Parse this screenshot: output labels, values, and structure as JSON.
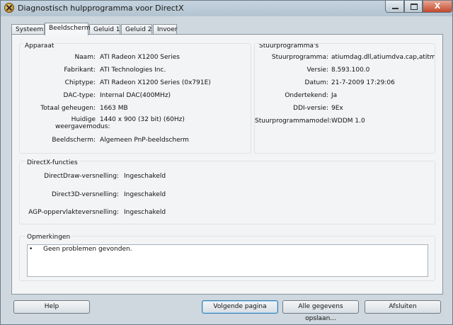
{
  "window": {
    "title": "Diagnostisch hulpprogramma voor DirectX"
  },
  "tabs": [
    "Systeem",
    "Beeldscherm",
    "Geluid 1",
    "Geluid 2",
    "Invoer"
  ],
  "active_tab": "Beeldscherm",
  "apparaat": {
    "heading": "Apparaat",
    "rows": [
      {
        "label": "Naam:",
        "value": "ATI Radeon X1200 Series"
      },
      {
        "label": "Fabrikant:",
        "value": "ATI Technologies Inc."
      },
      {
        "label": "Chiptype:",
        "value": "ATI Radeon X1200 Series (0x791E)"
      },
      {
        "label": "DAC-type:",
        "value": "Internal DAC(400MHz)"
      },
      {
        "label": "Totaal geheugen:",
        "value": "1663 MB"
      },
      {
        "label": "Huidige weergavemodus:",
        "value": "1440 x 900 (32 bit) (60Hz)"
      },
      {
        "label": "Beeldscherm:",
        "value": "Algemeen PnP-beeldscherm"
      }
    ]
  },
  "stuurprogrammas": {
    "heading": "Stuurprogramma's",
    "rows": [
      {
        "label": "Stuurprogramma:",
        "value": "atiumdag.dll,atiumdva.cap,atitmmx"
      },
      {
        "label": "Versie:",
        "value": "8.593.100.0"
      },
      {
        "label": "Datum:",
        "value": "21-7-2009 17:29:06"
      },
      {
        "label": "Ondertekend:",
        "value": "Ja"
      },
      {
        "label": "DDI-versie:",
        "value": "9Ex"
      },
      {
        "label": "Stuurprogrammamodel:",
        "value": "WDDM 1.0"
      }
    ]
  },
  "directx": {
    "heading": "DirectX-functies",
    "rows": [
      {
        "label": "DirectDraw-versnelling:",
        "value": "Ingeschakeld"
      },
      {
        "label": "Direct3D-versnelling:",
        "value": "Ingeschakeld"
      },
      {
        "label": "AGP-oppervlakteversnelling:",
        "value": "Ingeschakeld"
      }
    ]
  },
  "opmerkingen": {
    "heading": "Opmerkingen",
    "bullet": "•",
    "text": "Geen problemen gevonden."
  },
  "buttons": {
    "help": "Help",
    "next": "Volgende pagina",
    "save_all": "Alle gegevens opslaan...",
    "close": "Afsluiten"
  },
  "title_buttons": {
    "close_glyph": "X"
  }
}
